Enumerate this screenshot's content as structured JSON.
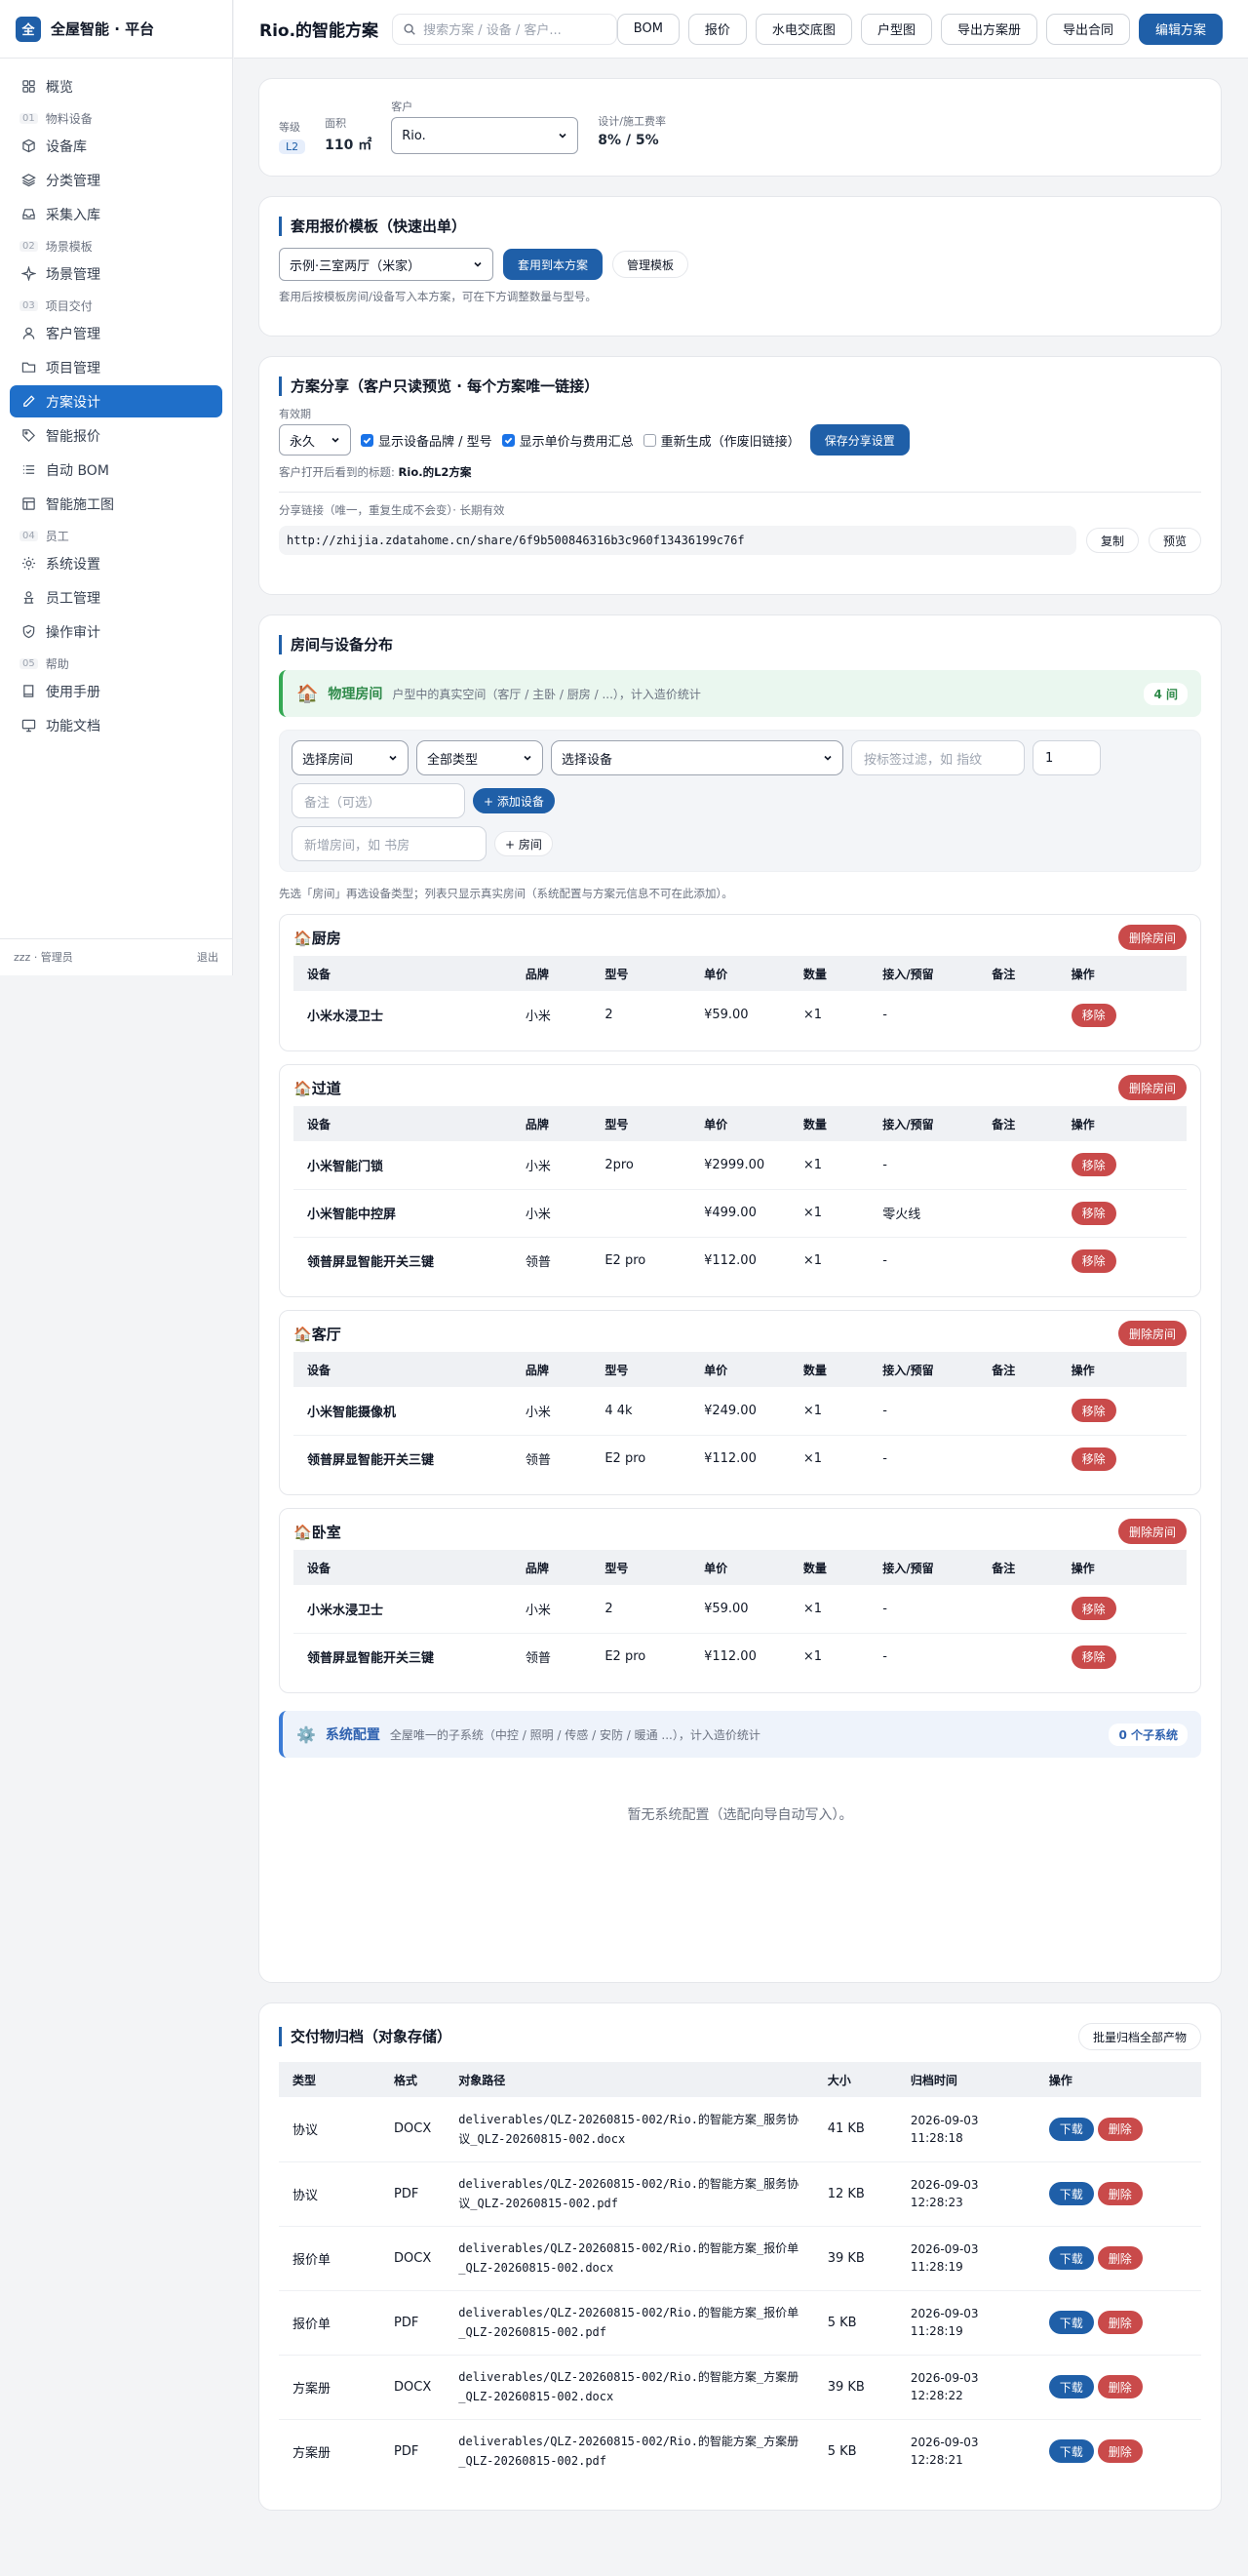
{
  "brand": {
    "logo": "全",
    "name": "全屋智能 · 平台"
  },
  "sidebar": {
    "overview": "概览",
    "g1": {
      "num": "01",
      "label": "物料设备"
    },
    "device_lib": "设备库",
    "category": "分类管理",
    "purchase": "采集入库",
    "g2": {
      "num": "02",
      "label": "场景模板"
    },
    "scene": "场景管理",
    "g3": {
      "num": "03",
      "label": "项目交付"
    },
    "customer": "客户管理",
    "project": "项目管理",
    "design": "方案设计",
    "quote": "智能报价",
    "bom": "自动 BOM",
    "drawing": "智能施工图",
    "g4": {
      "num": "04",
      "label": "员工"
    },
    "settings": "系统设置",
    "staff": "员工管理",
    "audit": "操作审计",
    "g5": {
      "num": "05",
      "label": "帮助"
    },
    "manual": "使用手册",
    "docs": "功能文档",
    "user": "zzz · 管理员",
    "logout": "退出"
  },
  "topbar": {
    "title": "Rio.的智能方案",
    "search_placeholder": "搜索方案 / 设备 / 客户...",
    "buttons": [
      "BOM",
      "报价",
      "水电交底图",
      "户型图",
      "导出方案册",
      "导出合同"
    ],
    "edit": "编辑方案"
  },
  "info": {
    "level_label": "等级",
    "level": "L2",
    "area_label": "面积",
    "area": "110 ㎡",
    "customer_label": "客户",
    "customer": "Rio.",
    "fee_label": "设计/施工费率",
    "fee": "8% / 5%"
  },
  "template": {
    "title": "套用报价模板（快速出单）",
    "selected": "示例·三室两厅（米家）",
    "apply": "套用到本方案",
    "manage": "管理模板",
    "hint": "套用后按模板房间/设备写入本方案，可在下方调整数量与型号。"
  },
  "share": {
    "title": "方案分享（客户只读预览 · 每个方案唯一链接）",
    "validity_label": "有效期",
    "validity": "永久",
    "opt1": "显示设备品牌 / 型号",
    "opt2": "显示单价与费用汇总",
    "opt3": "重新生成（作废旧链接）",
    "save": "保存分享设置",
    "title_hint": "客户打开后看到的标题:",
    "share_title": "Rio.的L2方案",
    "link_hint": "分享链接（唯一，重复生成不会变）· 长期有效",
    "url": "http://zhijia.zdatahome.cn/share/6f9b500846316b3c960f13436199c76f",
    "copy": "复制",
    "preview": "预览"
  },
  "rooms_card": {
    "title": "房间与设备分布",
    "physical": {
      "icon": "🏠",
      "title": "物理房间",
      "desc": "户型中的真实空间（客厅 / 主卧 / 厨房 / ...），计入造价统计",
      "count": "4 间"
    },
    "filter": {
      "room": "选择房间",
      "type": "全部类型",
      "device": "选择设备",
      "tag_placeholder": "按标签过滤，如 指纹",
      "qty": "1",
      "note_placeholder": "备注（可选）",
      "add_device": "+ 添加设备",
      "new_room_placeholder": "新增房间，如 书房",
      "add_room": "+ 房间"
    },
    "hint": "先选「房间」再选设备类型；列表只显示真实房间（系统配置与方案元信息不可在此添加）。",
    "headers": [
      "设备",
      "品牌",
      "型号",
      "单价",
      "数量",
      "接入/预留",
      "备注",
      "操作"
    ],
    "delete_room": "删除房间",
    "remove": "移除",
    "rooms": [
      {
        "icon": "🏠",
        "name": "厨房",
        "rows": [
          {
            "device": "小米水浸卫士",
            "brand": "小米",
            "model": "2",
            "price": "¥59.00",
            "qty": "×1",
            "access": "-",
            "note": ""
          }
        ]
      },
      {
        "icon": "🏠",
        "name": "过道",
        "rows": [
          {
            "device": "小米智能门锁",
            "brand": "小米",
            "model": "2pro",
            "price": "¥2999.00",
            "qty": "×1",
            "access": "-",
            "note": ""
          },
          {
            "device": "小米智能中控屏",
            "brand": "小米",
            "model": "",
            "price": "¥499.00",
            "qty": "×1",
            "access": "零火线",
            "note": ""
          },
          {
            "device": "领普屏显智能开关三键",
            "brand": "领普",
            "model": "E2 pro",
            "price": "¥112.00",
            "qty": "×1",
            "access": "-",
            "note": ""
          }
        ]
      },
      {
        "icon": "🏠",
        "name": "客厅",
        "rows": [
          {
            "device": "小米智能摄像机",
            "brand": "小米",
            "model": "4 4k",
            "price": "¥249.00",
            "qty": "×1",
            "access": "-",
            "note": ""
          },
          {
            "device": "领普屏显智能开关三键",
            "brand": "领普",
            "model": "E2 pro",
            "price": "¥112.00",
            "qty": "×1",
            "access": "-",
            "note": ""
          }
        ]
      },
      {
        "icon": "🏠",
        "name": "卧室",
        "rows": [
          {
            "device": "小米水浸卫士",
            "brand": "小米",
            "model": "2",
            "price": "¥59.00",
            "qty": "×1",
            "access": "-",
            "note": ""
          },
          {
            "device": "领普屏显智能开关三键",
            "brand": "领普",
            "model": "E2 pro",
            "price": "¥112.00",
            "qty": "×1",
            "access": "-",
            "note": ""
          }
        ]
      }
    ],
    "system": {
      "icon": "⚙️",
      "title": "系统配置",
      "desc": "全屋唯一的子系统（中控 / 照明 / 传感 / 安防 / 暖通 ...），计入造价统计",
      "count": "0 个子系统",
      "empty": "暂无系统配置（选配向导自动写入）。"
    }
  },
  "archive": {
    "title": "交付物归档（对象存储）",
    "batch": "批量归档全部产物",
    "headers": [
      "类型",
      "格式",
      "对象路径",
      "大小",
      "归档时间",
      "操作"
    ],
    "download": "下载",
    "delete": "删除",
    "rows": [
      {
        "type": "协议",
        "fmt": "DOCX",
        "path1": "deliverables/QLZ-20260815-002/Rio.的智能方案_服务协",
        "path2": "议_QLZ-20260815-002.docx",
        "size": "41 KB",
        "time1": "2026-09-03 11:28:18",
        "time2": ""
      },
      {
        "type": "协议",
        "fmt": "PDF",
        "path1": "deliverables/QLZ-20260815-002/Rio.的智能方案_服务协",
        "path2": "议_QLZ-20260815-002.pdf",
        "size": "12 KB",
        "time1": "2026-09-03",
        "time2": "12:28:23"
      },
      {
        "type": "报价单",
        "fmt": "DOCX",
        "path1": "deliverables/QLZ-20260815-002/Rio.的智能方案_报价单",
        "path2": "_QLZ-20260815-002.docx",
        "size": "39 KB",
        "time1": "2026-09-03 11:28:19",
        "time2": ""
      },
      {
        "type": "报价单",
        "fmt": "PDF",
        "path1": "deliverables/QLZ-20260815-002/Rio.的智能方案_报价单",
        "path2": "_QLZ-20260815-002.pdf",
        "size": "5 KB",
        "time1": "2026-09-03 11:28:19",
        "time2": ""
      },
      {
        "type": "方案册",
        "fmt": "DOCX",
        "path1": "deliverables/QLZ-20260815-002/Rio.的智能方案_方案册",
        "path2": "_QLZ-20260815-002.docx",
        "size": "39 KB",
        "time1": "2026-09-03",
        "time2": "12:28:22"
      },
      {
        "type": "方案册",
        "fmt": "PDF",
        "path1": "deliverables/QLZ-20260815-002/Rio.的智能方案_方案册",
        "path2": "_QLZ-20260815-002.pdf",
        "size": "5 KB",
        "time1": "2026-09-03",
        "time2": "12:28:21"
      }
    ]
  }
}
